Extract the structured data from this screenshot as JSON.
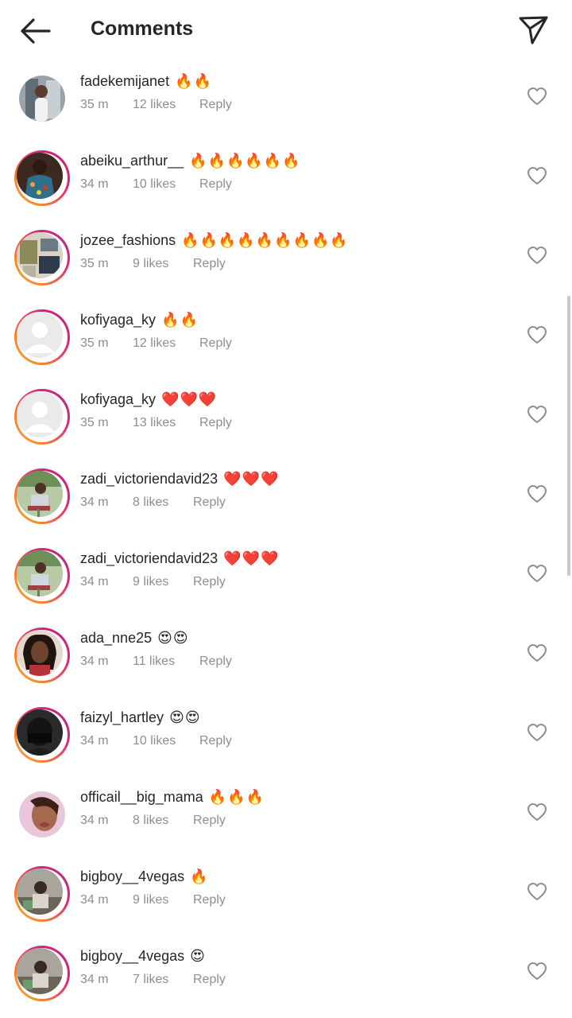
{
  "header": {
    "title": "Comments",
    "back_icon": "arrow-left-icon",
    "send_icon": "paper-plane-icon"
  },
  "colors": {
    "text": "#262626",
    "meta": "#8e8e8e",
    "ring_gradient": [
      "#f9b44a",
      "#f58529",
      "#dd2a7b",
      "#b1237e"
    ]
  },
  "comments": [
    {
      "username": "fadekemijanet",
      "emoji": "🔥🔥",
      "time": "35 m",
      "likes": "12 likes",
      "reply": "Reply",
      "story_ring": false,
      "avatar": "photo"
    },
    {
      "username": "abeiku_arthur__",
      "emoji": "🔥🔥🔥🔥🔥🔥",
      "time": "34 m",
      "likes": "10 likes",
      "reply": "Reply",
      "story_ring": true,
      "avatar": "photo"
    },
    {
      "username": "jozee_fashions",
      "emoji": "🔥🔥🔥🔥🔥🔥🔥🔥🔥",
      "time": "35 m",
      "likes": "9 likes",
      "reply": "Reply",
      "story_ring": true,
      "avatar": "photo"
    },
    {
      "username": "kofiyaga_ky",
      "emoji": "🔥🔥",
      "time": "35 m",
      "likes": "12 likes",
      "reply": "Reply",
      "story_ring": true,
      "avatar": "default"
    },
    {
      "username": "kofiyaga_ky",
      "emoji": "❤️❤️❤️",
      "time": "35 m",
      "likes": "13 likes",
      "reply": "Reply",
      "story_ring": true,
      "avatar": "default"
    },
    {
      "username": "zadi_victoriendavid23",
      "emoji": "❤️❤️❤️",
      "time": "34 m",
      "likes": "8 likes",
      "reply": "Reply",
      "story_ring": true,
      "avatar": "photo"
    },
    {
      "username": "zadi_victoriendavid23",
      "emoji": "❤️❤️❤️",
      "time": "34 m",
      "likes": "9 likes",
      "reply": "Reply",
      "story_ring": true,
      "avatar": "photo"
    },
    {
      "username": "ada_nne25",
      "emoji": "😍😍",
      "time": "34 m",
      "likes": "11 likes",
      "reply": "Reply",
      "story_ring": true,
      "avatar": "photo"
    },
    {
      "username": "faizyl_hartley",
      "emoji": "😍😍",
      "time": "34 m",
      "likes": "10 likes",
      "reply": "Reply",
      "story_ring": true,
      "avatar": "photo"
    },
    {
      "username": "officail__big_mama",
      "emoji": "🔥🔥🔥",
      "time": "34 m",
      "likes": "8 likes",
      "reply": "Reply",
      "story_ring": false,
      "avatar": "photo"
    },
    {
      "username": "bigboy__4vegas",
      "emoji": "🔥",
      "time": "34 m",
      "likes": "9 likes",
      "reply": "Reply",
      "story_ring": true,
      "avatar": "photo"
    },
    {
      "username": "bigboy__4vegas",
      "emoji": "😍",
      "time": "34 m",
      "likes": "7 likes",
      "reply": "Reply",
      "story_ring": true,
      "avatar": "photo"
    }
  ]
}
